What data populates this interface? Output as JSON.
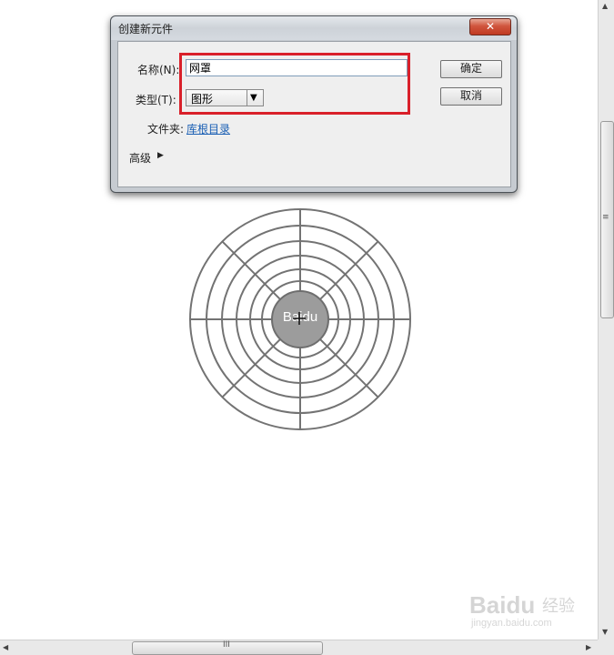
{
  "dialog": {
    "title": "创建新元件",
    "close_glyph": "✕",
    "name_label": "名称(N):",
    "name_value": "网罩",
    "type_label": "类型(T):",
    "type_value": "图形",
    "type_arrow": "▼",
    "folder_label": "文件夹:",
    "folder_link": "库根目录",
    "advanced_label": "高级",
    "advanced_arrow": "▶",
    "ok_label": "确定",
    "cancel_label": "取消",
    "highlight_color": "#d9202a"
  },
  "canvas": {
    "center_label": "Baidu",
    "line_color": "#737373",
    "hub_color": "#9c9c9c"
  },
  "scrollbars": {
    "grip_vertical": "≡",
    "grip_horizontal": "III",
    "up": "▲",
    "down": "▼",
    "left": "◀",
    "right": "▶"
  },
  "watermark": {
    "brand": "Baidu",
    "product": "经验",
    "url": "jingyan.baidu.com"
  }
}
